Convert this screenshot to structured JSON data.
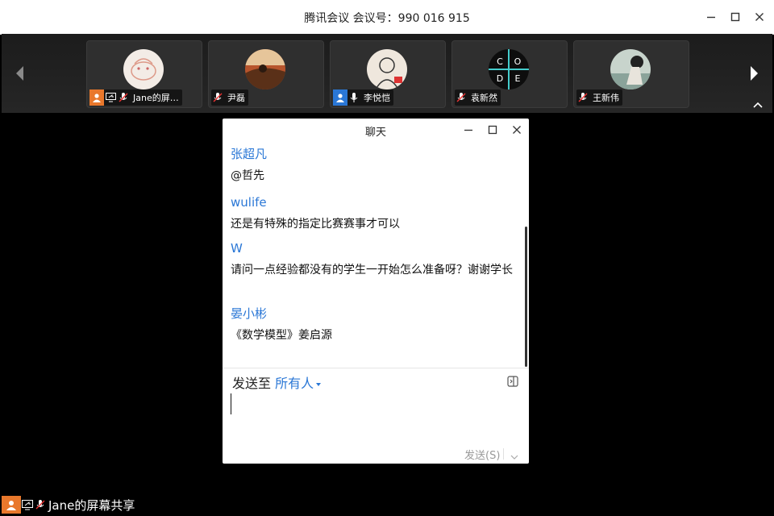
{
  "window": {
    "title": "腾讯会议 会议号：990 016 915"
  },
  "participants": [
    {
      "name": "Jane的屏…",
      "mic": "muted",
      "sharing": true,
      "avatar_bg": "#f3ece6"
    },
    {
      "name": "尹磊",
      "mic": "muted",
      "sharing": false,
      "avatar_bg": "#b7542c"
    },
    {
      "name": "李悦恺",
      "mic": "on",
      "sharing": false,
      "avatar_bg": "#efe7dd"
    },
    {
      "name": "袁新然",
      "mic": "muted",
      "sharing": false,
      "avatar_bg": "#0d0d0d",
      "logo_letters": [
        "C",
        "O",
        "D",
        "E"
      ]
    },
    {
      "name": "王新伟",
      "mic": "muted",
      "sharing": false,
      "avatar_bg": "#c8d4cc"
    }
  ],
  "chat": {
    "title": "聊天",
    "messages": [
      {
        "sender": "张超凡",
        "text": "@哲先"
      },
      {
        "sender": "wulife",
        "text": "还是有特殊的指定比赛赛事才可以"
      },
      {
        "sender": "W",
        "text": "请问一点经验都没有的学生一开始怎么准备呀？谢谢学长"
      },
      {
        "sender": "晏小彬",
        "text": "《数学模型》姜启源"
      }
    ],
    "send_to_label": "发送至",
    "send_to_target": "所有人",
    "input_value": "",
    "send_button": "发送(S)"
  },
  "screen_share": {
    "label": "Jane的屏幕共享"
  },
  "colors": {
    "accent": "#2a77d6",
    "host_badge": "#e9782c",
    "background": "#000000"
  }
}
